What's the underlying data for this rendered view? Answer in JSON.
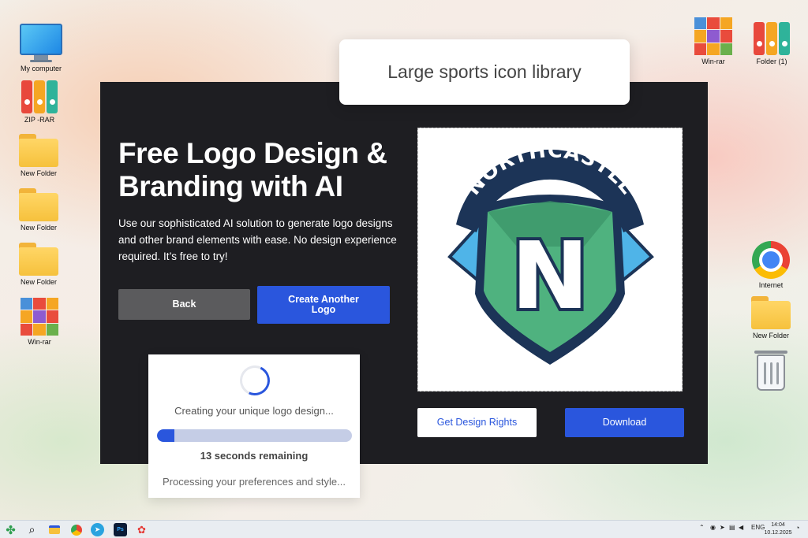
{
  "desktop": {
    "left_icons": [
      {
        "label": "My computer",
        "icon": "monitor-icon"
      },
      {
        "label": "ZIP -RAR",
        "icon": "binders-icon"
      },
      {
        "label": "New Folder",
        "icon": "folder-icon"
      },
      {
        "label": "New Folder",
        "icon": "folder-icon"
      },
      {
        "label": "New Folder",
        "icon": "folder-icon"
      },
      {
        "label": "Win-rar",
        "icon": "winrar-icon"
      }
    ],
    "right_icons": [
      {
        "label": "Win-rar",
        "icon": "winrar-icon"
      },
      {
        "label": "Folder (1)",
        "icon": "binders-icon"
      },
      {
        "label": "Internet",
        "icon": "chrome-icon"
      },
      {
        "label": "New Folder",
        "icon": "folder-icon"
      },
      {
        "label": "",
        "icon": "recycle-bin-icon"
      }
    ]
  },
  "tooltip": {
    "text": "Large sports icon library"
  },
  "panel": {
    "headline": "Free Logo Design & Branding with AI",
    "subtext": "Use our sophisticated AI solution to generate logo designs and other brand elements with ease. No design experience required. It’s free to try!",
    "back_label": "Back",
    "create_label": "Create Another Logo",
    "rights_label": "Get Design Rights",
    "download_label": "Download",
    "logo": {
      "arc_text": "NORTHCASTLE",
      "letter": "N",
      "colors": {
        "navy": "#1c3457",
        "green": "#4fb27f",
        "dark_green": "#3a9366",
        "sky": "#4fb4e8"
      }
    }
  },
  "progress": {
    "message": "Creating your unique logo design...",
    "progress_percent": 9,
    "time_remaining": "13 seconds remaining",
    "footer": "Processing your preferences and style..."
  },
  "taskbar": {
    "language": "ENG",
    "time": "14:04",
    "date": "10.12.2025"
  },
  "colors": {
    "accent": "#2a56dd",
    "panel_bg": "#1e1e22"
  }
}
